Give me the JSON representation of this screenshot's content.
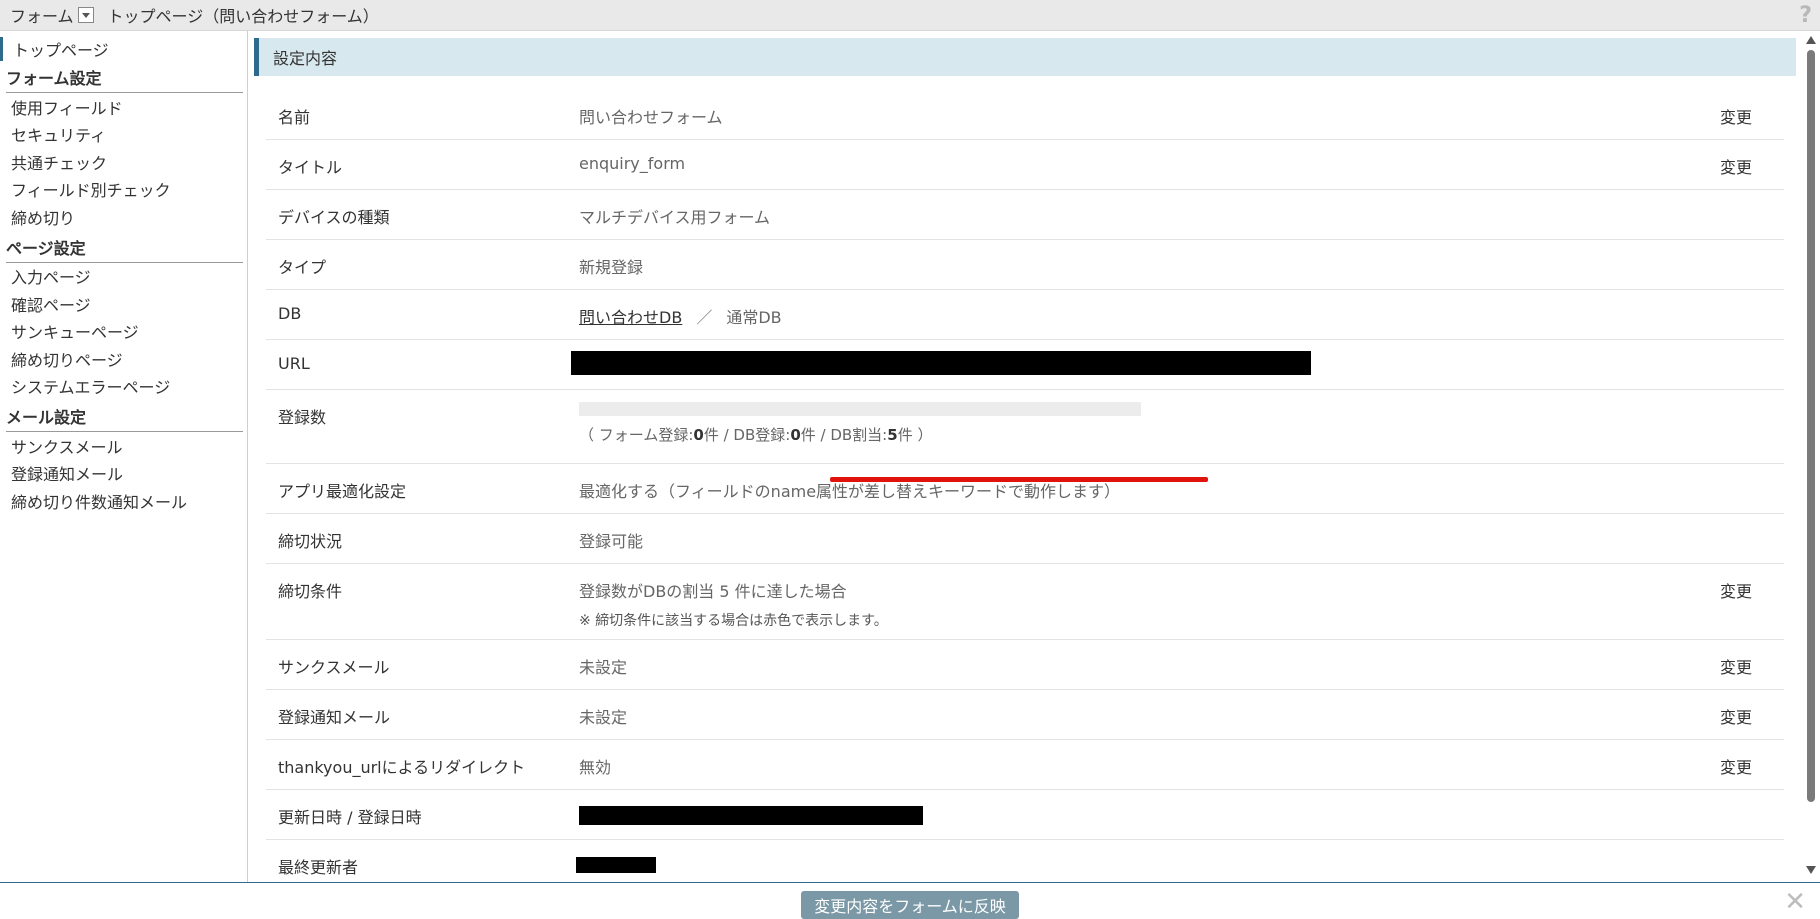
{
  "topbar": {
    "form_menu": "フォーム",
    "breadcrumb": "トップページ（問い合わせフォーム）",
    "help": "?"
  },
  "sidebar": {
    "top_item": "トップページ",
    "form_settings": {
      "heading": "フォーム設定",
      "items": [
        "使用フィールド",
        "セキュリティ",
        "共通チェック",
        "フィールド別チェック",
        "締め切り"
      ]
    },
    "page_settings": {
      "heading": "ページ設定",
      "items": [
        "入力ページ",
        "確認ページ",
        "サンキューページ",
        "締め切りページ",
        "システムエラーページ"
      ]
    },
    "mail_settings": {
      "heading": "メール設定",
      "items": [
        "サンクスメール",
        "登録通知メール",
        "締め切り件数通知メール"
      ]
    }
  },
  "main": {
    "section_title": "設定内容",
    "change_label": "変更",
    "rows": {
      "name": {
        "label": "名前",
        "value": "問い合わせフォーム"
      },
      "title": {
        "label": "タイトル",
        "value": "enquiry_form"
      },
      "device": {
        "label": "デバイスの種類",
        "value": "マルチデバイス用フォーム"
      },
      "type": {
        "label": "タイプ",
        "value": "新規登録"
      },
      "db": {
        "label": "DB",
        "link": "問い合わせDB",
        "separator": "／",
        "value": "通常DB"
      },
      "url": {
        "label": "URL"
      },
      "count": {
        "label": "登録数",
        "progress": 0,
        "open": "（ フォーム登録:",
        "form_count": "0",
        "mid1": "件 / DB登録:",
        "db_count": "0",
        "mid2": "件 / DB割当:",
        "alloc": "5",
        "close": "件 ）"
      },
      "app_opt": {
        "label": "アプリ最適化設定",
        "value": "最適化する（フィールドのname属性が差し替えキーワードで動作します）"
      },
      "status": {
        "label": "締切状況",
        "value": "登録可能"
      },
      "condition": {
        "label": "締切条件",
        "value": "登録数がDBの割当 5 件に達した場合",
        "note": "※ 締切条件に該当する場合は赤色で表示します。"
      },
      "thanks_mail": {
        "label": "サンクスメール",
        "value": "未設定"
      },
      "notify_mail": {
        "label": "登録通知メール",
        "value": "未設定"
      },
      "redirect": {
        "label": "thankyou_urlによるリダイレクト",
        "value": "無効"
      },
      "dates": {
        "label": "更新日時 / 登録日時"
      },
      "last_editor": {
        "label": "最終更新者"
      }
    }
  },
  "footer": {
    "apply_button": "変更内容をフォームに反映",
    "close": "✕"
  },
  "colors": {
    "accent": "#2d6a8e",
    "section_bg": "#d8e8ef",
    "button_bg": "#7a98a5",
    "highlight_red": "#e0140c"
  }
}
